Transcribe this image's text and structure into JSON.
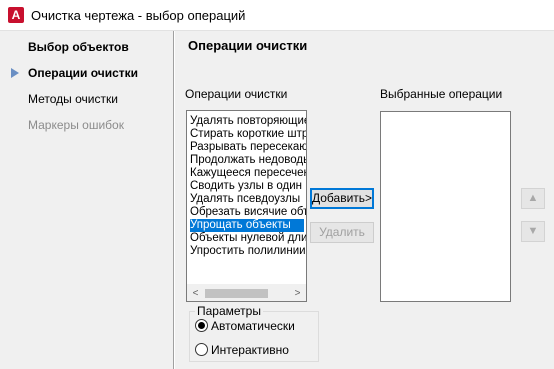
{
  "window": {
    "title": "Очистка чертежа - выбор операций",
    "app_icon_letter": "A"
  },
  "nav": {
    "items": [
      {
        "label": "Выбор объектов",
        "state": "bold"
      },
      {
        "label": "Операции очистки",
        "state": "current"
      },
      {
        "label": "Методы очистки",
        "state": "normal"
      },
      {
        "label": "Маркеры ошибок",
        "state": "disabled"
      }
    ]
  },
  "main": {
    "title": "Операции очистки",
    "available_label": "Операции очистки",
    "selected_label": "Выбранные операции",
    "operations": [
      "Удалять повторяющиеся",
      "Стирать короткие штрихи",
      "Разрывать пересекающиеся",
      "Продолжать недоводы",
      "Кажущееся пересечение",
      "Сводить узлы в один",
      "Удалять псевдоузлы",
      "Обрезать висячие объекты",
      "Упрощать объекты",
      "Объекты нулевой длины",
      "Упростить полилинии"
    ],
    "selected_operation": "Упрощать объекты",
    "selected_operations": [],
    "add_button": "Добавить>",
    "remove_button": "Удалить",
    "scroll_left": "<",
    "scroll_right": ">",
    "move_up_icon": "arrow-up-icon",
    "move_down_icon": "arrow-down-icon"
  },
  "parameters": {
    "title": "Параметры",
    "options": [
      {
        "label": "Автоматически",
        "checked": true
      },
      {
        "label": "Интерактивно",
        "checked": false
      }
    ]
  },
  "colors": {
    "selection": "#0078d7",
    "brand": "#c8102e",
    "nav_arrow": "#6a8fc4"
  }
}
